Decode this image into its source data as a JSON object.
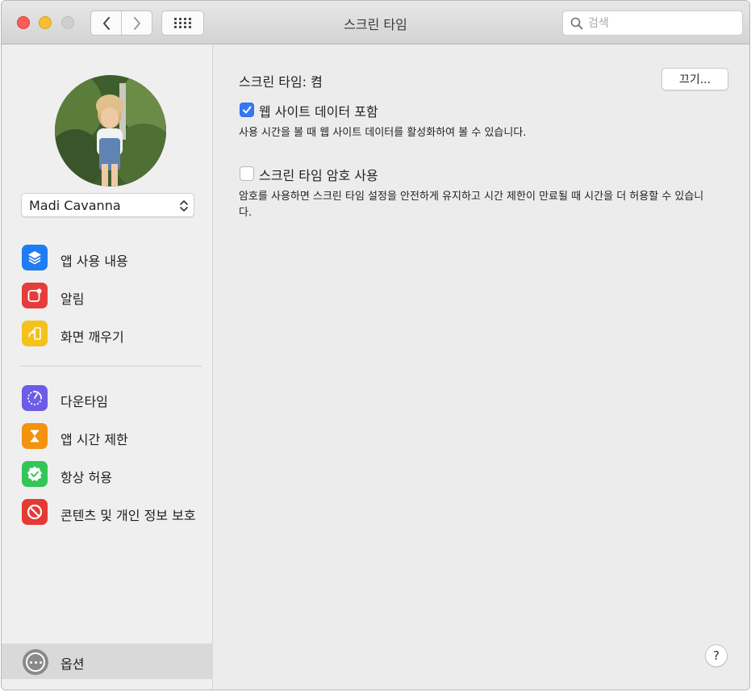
{
  "window": {
    "title": "스크린 타임",
    "search_placeholder": "검색"
  },
  "sidebar": {
    "user_name": "Madi Cavanna",
    "items_top": [
      {
        "label": "앱 사용 내용",
        "icon": "layers-icon",
        "color": "#1f7cf2"
      },
      {
        "label": "알림",
        "icon": "notification-icon",
        "color": "#e73c3c"
      },
      {
        "label": "화면 깨우기",
        "icon": "pickup-icon",
        "color": "#f4c21a"
      }
    ],
    "items_bottom": [
      {
        "label": "다운타임",
        "icon": "downtime-icon",
        "color": "#6c5ce7"
      },
      {
        "label": "앱 시간 제한",
        "icon": "hourglass-icon",
        "color": "#f3920d"
      },
      {
        "label": "항상 허용",
        "icon": "checkmark-badge-icon",
        "color": "#34c559"
      },
      {
        "label": "콘텐츠 및 개인 정보 보호",
        "icon": "restriction-icon",
        "color": "#e53935"
      }
    ],
    "options_label": "옵션"
  },
  "main": {
    "status_text": "스크린 타임: 켬",
    "off_button": "끄기...",
    "web_data": {
      "label": "웹 사이트 데이터 포함",
      "checked": true,
      "description": "사용 시간을 볼 때 웹 사이트 데이터를 활성화하여 볼 수 있습니다."
    },
    "passcode": {
      "label": "스크린 타임 암호 사용",
      "checked": false,
      "description": "암호를 사용하면 스크린 타임 설정을 안전하게 유지하고 시간 제한이 만료될 때 시간을 더 허용할 수 있습니다."
    },
    "help_label": "?"
  }
}
